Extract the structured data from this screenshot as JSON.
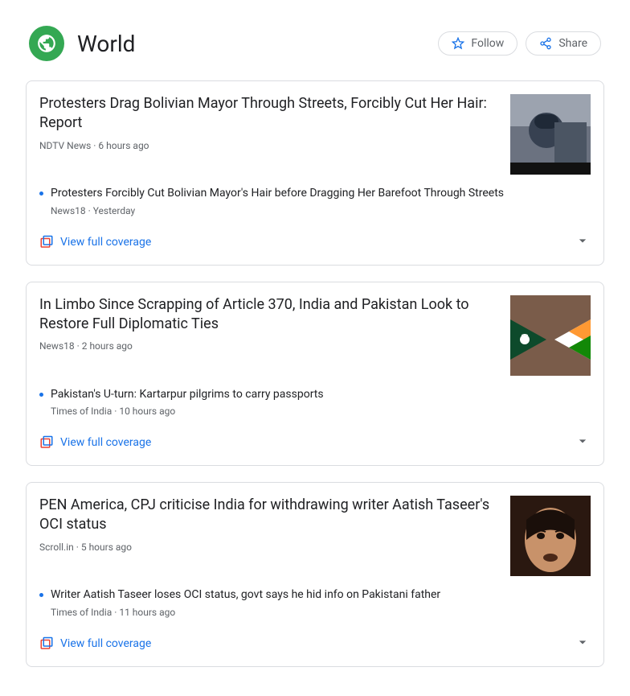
{
  "header": {
    "topic_label": "World",
    "follow_label": "Follow",
    "share_label": "Share",
    "coverage_label": "View full coverage"
  },
  "stories": [
    {
      "headline": "Protesters Drag Bolivian Mayor Through Streets, Forcibly Cut Her Hair: Report",
      "source": "NDTV News",
      "time": "6 hours ago",
      "related": {
        "headline": "Protesters Forcibly Cut Bolivian Mayor's Hair before Dragging Her Barefoot Through Streets",
        "source": "News18",
        "time": "Yesterday"
      }
    },
    {
      "headline": "In Limbo Since Scrapping of Article 370, India and Pakistan Look to Restore Full Diplomatic Ties",
      "source": "News18",
      "time": "2 hours ago",
      "related": {
        "headline": "Pakistan's U-turn: Kartarpur pilgrims to carry passports",
        "source": "Times of India",
        "time": "10 hours ago"
      }
    },
    {
      "headline": "PEN America, CPJ criticise India for withdrawing writer Aatish Taseer's OCI status",
      "source": "Scroll.in",
      "time": "5 hours ago",
      "related": {
        "headline": "Writer Aatish Taseer loses OCI status, govt says he hid info on Pakistani father",
        "source": "Times of India",
        "time": "11 hours ago"
      }
    }
  ]
}
